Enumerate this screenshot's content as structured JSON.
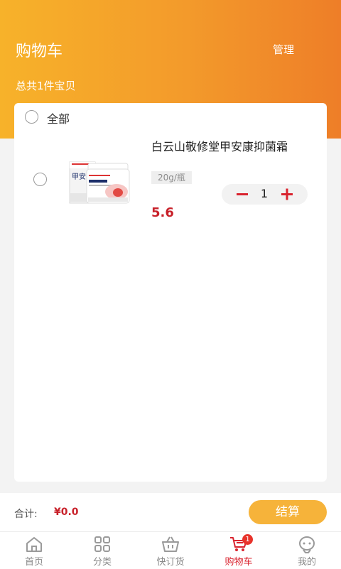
{
  "header": {
    "title": "购物车",
    "manage_label": "管理",
    "total_text": "总共1件宝贝",
    "gradient_colors": [
      "#f7b22a",
      "#ee7e28"
    ]
  },
  "cart": {
    "select_all_label": "全部",
    "items": [
      {
        "name": "白云山敬修堂甲安康抑菌霜",
        "spec": "20g/瓶",
        "price": "5.6",
        "quantity": "1",
        "minus_icon": "minus-icon",
        "plus_icon": "plus-icon",
        "box_label": "甲安"
      }
    ]
  },
  "checkout": {
    "sum_label": "合计:",
    "sum_value": "¥0.0",
    "button_label": "结算",
    "button_color": "#f6b33a"
  },
  "tabs": [
    {
      "label": "首页",
      "icon": "home-icon",
      "active": false
    },
    {
      "label": "分类",
      "icon": "grid-icon",
      "active": false
    },
    {
      "label": "快订货",
      "icon": "basket-icon",
      "active": false
    },
    {
      "label": "购物车",
      "icon": "cart-icon",
      "active": true,
      "badge": "1"
    },
    {
      "label": "我的",
      "icon": "profile-icon",
      "active": false
    }
  ],
  "colors": {
    "accent_red": "#d9232e",
    "price_red": "#c8212a"
  }
}
